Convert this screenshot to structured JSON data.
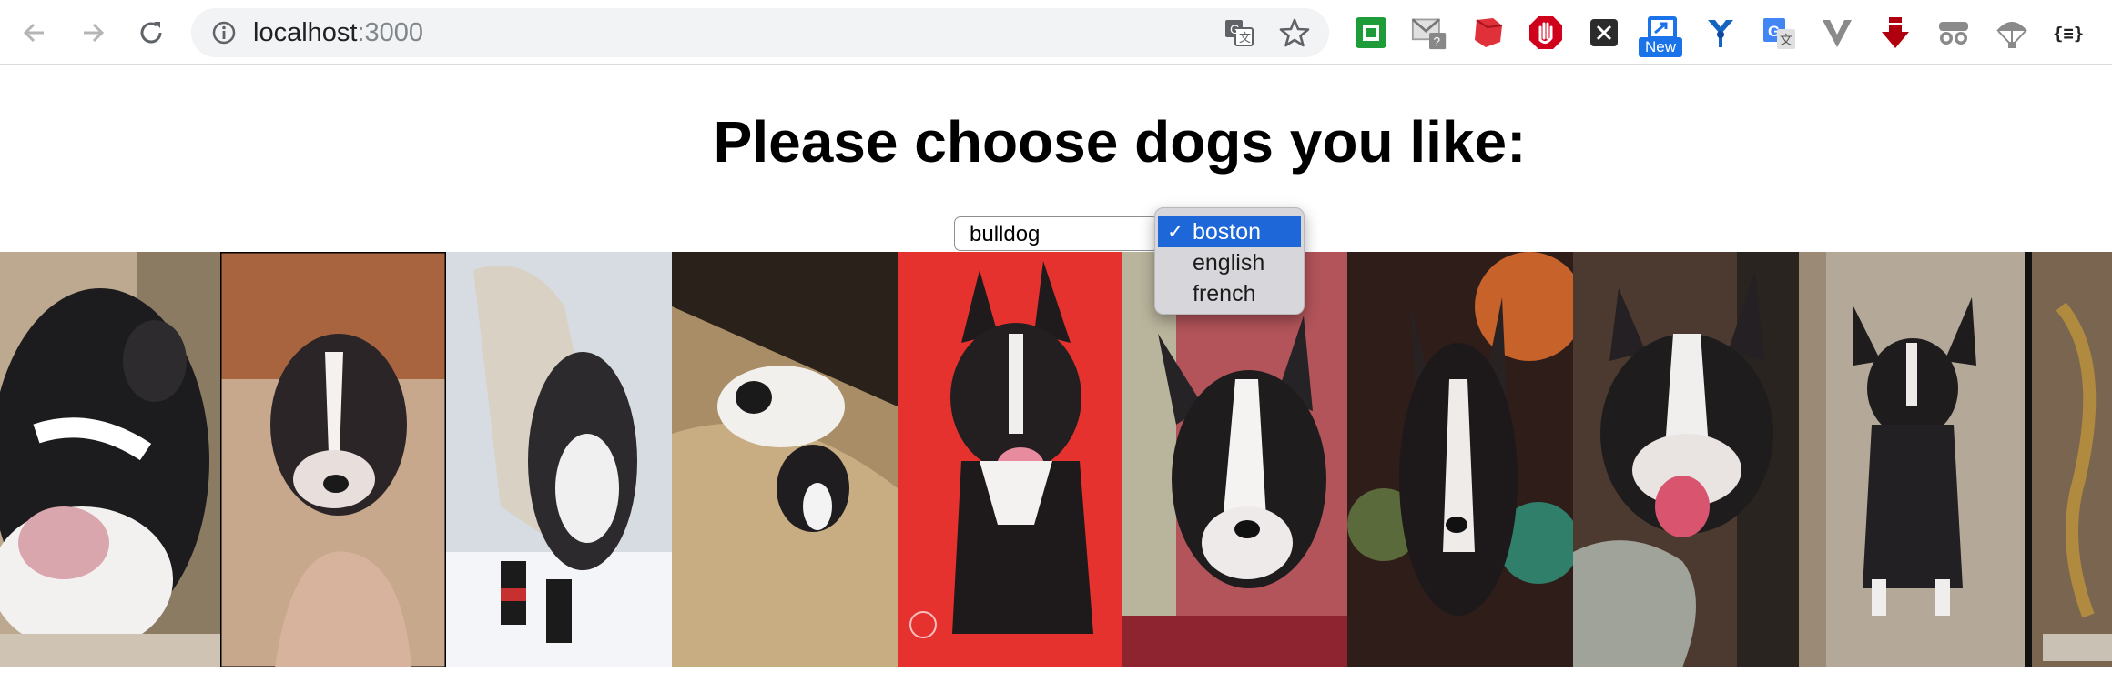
{
  "browser": {
    "url_host": "localhost",
    "url_port": ":3000",
    "extensions": [
      "green-square",
      "gmail-checker",
      "red-cube",
      "stop-hand",
      "x-app",
      "new-tab",
      "blue-pin",
      "google-translate",
      "v-shield",
      "red-arrow",
      "incognito-glasses",
      "parachute",
      "json-braces"
    ],
    "new_badge": "New"
  },
  "page": {
    "heading": "Please choose dogs you like:",
    "select_value": "bulldog",
    "dropdown": {
      "options": [
        "boston",
        "english",
        "french"
      ],
      "selected": "boston"
    },
    "photo_count": 10
  },
  "colors": {
    "accent": "#1e67d8",
    "omnibox": "#f1f3f4"
  }
}
